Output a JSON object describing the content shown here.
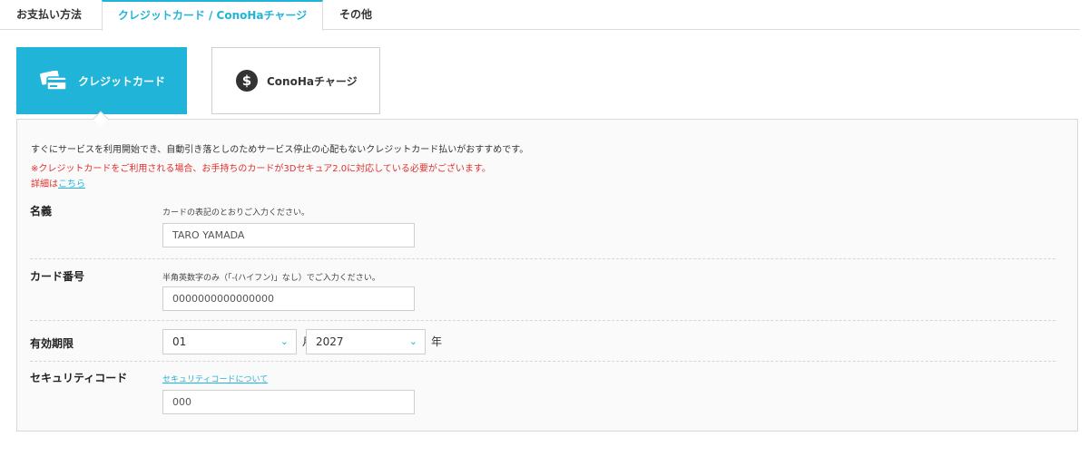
{
  "tabs": [
    {
      "label": "お支払い方法"
    },
    {
      "label": "クレジットカード / ConoHaチャージ"
    },
    {
      "label": "その他"
    }
  ],
  "methods": {
    "credit": {
      "label": "クレジットカード",
      "icon": "credit-card-icon"
    },
    "conoha": {
      "label": "ConoHaチャージ",
      "icon": "dollar-icon",
      "icon_glyph": "$"
    }
  },
  "panel": {
    "intro": "すぐにサービスを利用開始でき、自動引き落としのためサービス停止の心配もないクレジットカード払いがおすすめです。",
    "warning": "※クレジットカードをご利用される場合、お手持ちのカードが3Dセキュア2.0に対応している必要がございます。",
    "detail_prefix": "詳細は",
    "detail_link": "こちら"
  },
  "form": {
    "name": {
      "label": "名義",
      "hint": "カードの表記のとおりご入力ください。",
      "value": "TARO YAMADA"
    },
    "number": {
      "label": "カード番号",
      "hint": "半角英数字のみ（「-(ハイフン)」なし）でご入力ください。",
      "value": "0000000000000000"
    },
    "expiry": {
      "label": "有効期限",
      "month": "01",
      "month_unit": "月",
      "year": "2027",
      "year_unit": "年"
    },
    "security": {
      "label": "セキュリティコード",
      "hint_link": "セキュリティコードについて",
      "value": "000"
    }
  },
  "colors": {
    "accent": "#20b4d8",
    "warning": "#e0302c"
  }
}
